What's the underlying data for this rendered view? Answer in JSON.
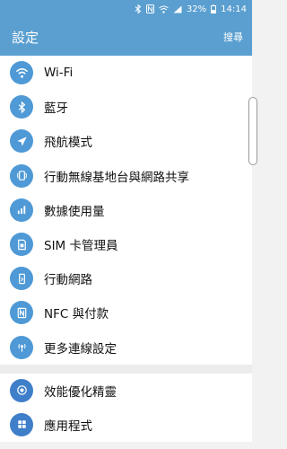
{
  "status": {
    "battery": "32%",
    "time": "14:14"
  },
  "header": {
    "title": "設定",
    "search_label": "搜尋"
  },
  "settings": [
    {
      "label": "Wi-Fi",
      "icon": "wifi-icon"
    },
    {
      "label": "藍牙",
      "icon": "bluetooth-icon"
    },
    {
      "label": "飛航模式",
      "icon": "airplane-icon"
    },
    {
      "label": "行動無線基地台與網路共享",
      "icon": "hotspot-icon"
    },
    {
      "label": "數據使用量",
      "icon": "data-usage-icon"
    },
    {
      "label": "SIM 卡管理員",
      "icon": "sim-icon"
    },
    {
      "label": "行動網路",
      "icon": "mobile-network-icon"
    },
    {
      "label": "NFC 與付款",
      "icon": "nfc-icon"
    },
    {
      "label": "更多連線設定",
      "icon": "more-connections-icon"
    }
  ],
  "settings2": [
    {
      "label": "效能優化精靈",
      "icon": "optimize-icon"
    },
    {
      "label": "應用程式",
      "icon": "apps-icon"
    }
  ],
  "colors": {
    "accent": "#5a9fd0",
    "icon_bg": "#4e99d6"
  }
}
